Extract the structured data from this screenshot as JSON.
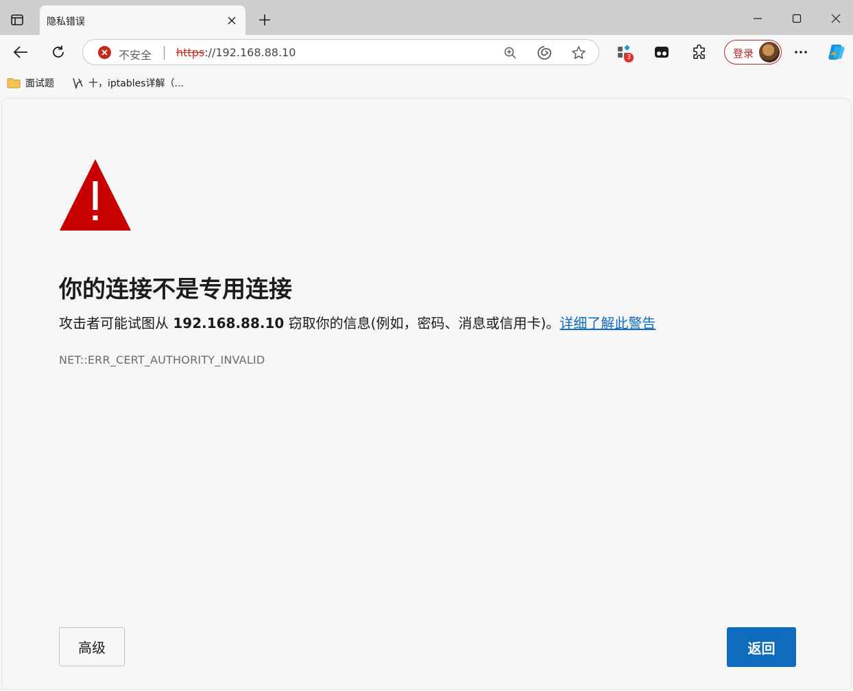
{
  "tab": {
    "title": "隐私错误"
  },
  "addressbar": {
    "security_label": "不安全",
    "url_scheme": "https",
    "url_rest": "://192.168.88.10"
  },
  "toolbar": {
    "extensions_badge": "3",
    "login_label": "登录"
  },
  "bookmarks": [
    {
      "label": "面试题",
      "icon": "folder-icon"
    },
    {
      "label": "十，iptables详解（...",
      "icon": "bookmark-page-icon"
    }
  ],
  "error_page": {
    "heading": "你的连接不是专用连接",
    "desc_prefix": "攻击者可能试图从",
    "desc_host": "192.168.88.10",
    "desc_suffix": "窃取你的信息(例如，密码、消息或信用卡)。",
    "learn_more": "详细了解此警告",
    "error_code": "NET::ERR_CERT_AUTHORITY_INVALID",
    "advanced_label": "高级",
    "back_label": "返回"
  },
  "colors": {
    "warning_red": "#c80000",
    "accent_blue": "#0f6cbd",
    "insecure_red": "#c42b1c"
  }
}
